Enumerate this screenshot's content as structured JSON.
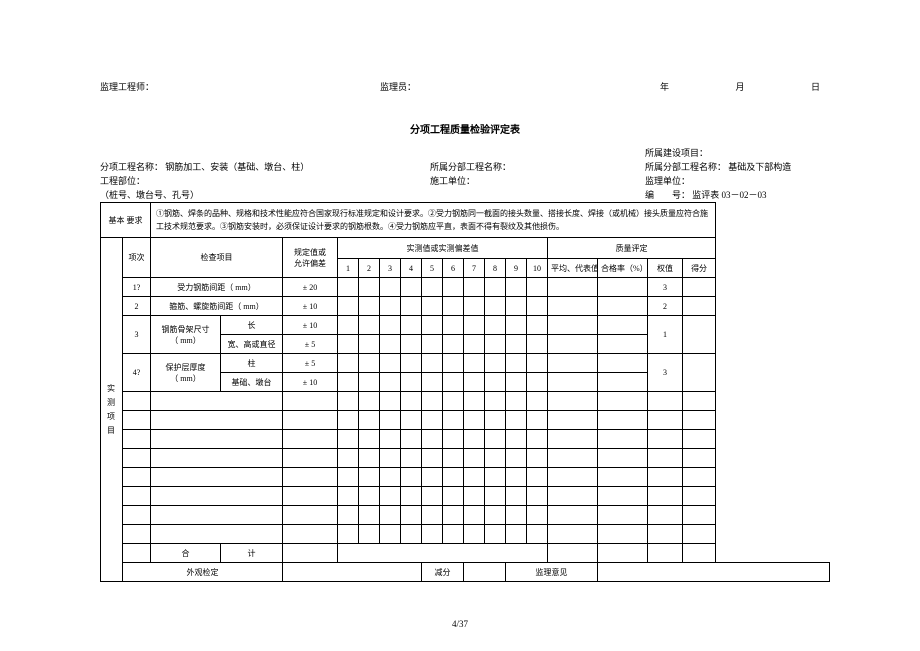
{
  "header": {
    "engineer_label": "监理工程师：",
    "inspector_label": "监理员：",
    "year": "年",
    "month": "月",
    "day": "日"
  },
  "title": "分项工程质量检验评定表",
  "meta": {
    "owner_label": "所属建设项目：",
    "sub_name_label": "分项工程名称：",
    "sub_name_value": "钢筋加工、安装（基础、墩台、柱）",
    "part_label": "所属分部工程名称：",
    "part2_label": "所属分部工程名称：",
    "part2_value": "基础及下部构造",
    "pos_label": "工程部位：",
    "unit_label": "施工单位：",
    "super_label": "监理单位：",
    "pile_label": "（桩号、墩台号、孔号）",
    "code_label": "编　　号：",
    "code_value": "监评表 03－02－03"
  },
  "basic_req": {
    "label": "基本\n要求",
    "content": "①钢筋、焊条的品种、规格和技术性能应符合国家现行标准规定和设计要求。②受力钢筋同一截面的接头数量、搭接长度、焊接（或机械）接头质量应符合施工技术规范要求。③钢筋安装时，必须保证设计要求的钢筋根数。④受力钢筋应平直，表面不得有裂纹及其他损伤。"
  },
  "vlabel": "实\n测\n项\n目",
  "headers": {
    "idx": "项次",
    "item": "检查项目",
    "tol": "规定值或\n允许偏差",
    "meas": "实测值或实测偏差值",
    "qual": "质量评定",
    "c1": "1",
    "c2": "2",
    "c3": "3",
    "c4": "4",
    "c5": "5",
    "c6": "6",
    "c7": "7",
    "c8": "8",
    "c9": "9",
    "c10": "10",
    "avg": "平均、代表值",
    "pass": "合格率（%）",
    "wt": "权值",
    "score": "得分"
  },
  "rows": [
    {
      "idx": "1?",
      "a": "受力钢筋间距（ mm）",
      "b": "",
      "tol": "± 20",
      "wt": "3"
    },
    {
      "idx": "2",
      "a": "箍筋、螺旋筋间距（ mm）",
      "b": "",
      "tol": "± 10",
      "wt": "2"
    },
    {
      "idx": "3",
      "a": "钢筋骨架尺寸\n（ mm）",
      "b": "长",
      "tol": "± 10",
      "wt": "1"
    },
    {
      "idx": "",
      "a": "",
      "b": "宽、高或直径",
      "tol": "± 5",
      "wt": ""
    },
    {
      "idx": "4?",
      "a": "保护层厚度\n（ mm）",
      "b": "柱",
      "tol": "± 5",
      "wt": "3"
    },
    {
      "idx": "",
      "a": "",
      "b": "基础、墩台",
      "tol": "± 10",
      "wt": ""
    }
  ],
  "sum": {
    "he": "合",
    "ji": "计"
  },
  "bottom": {
    "visual": "外观检定",
    "deduct": "减分",
    "opinion": "监理意见"
  },
  "footer": "4/37"
}
